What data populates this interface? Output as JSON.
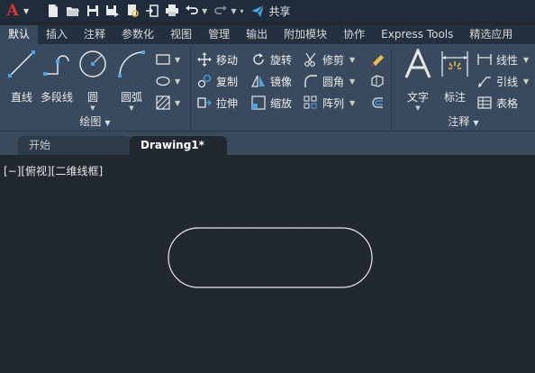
{
  "quick_access": {
    "app_menu_icon": "autocad-a-logo",
    "share_label": "共享",
    "icons": [
      "new-icon",
      "open-icon",
      "save-icon",
      "save-as-icon",
      "plot-preview-icon",
      "export-icon",
      "print-icon",
      "undo-icon",
      "redo-icon",
      "customize-icon"
    ]
  },
  "ribbon_tabs": [
    {
      "label": "默认",
      "active": true
    },
    {
      "label": "插入",
      "active": false
    },
    {
      "label": "注释",
      "active": false
    },
    {
      "label": "参数化",
      "active": false
    },
    {
      "label": "视图",
      "active": false
    },
    {
      "label": "管理",
      "active": false
    },
    {
      "label": "输出",
      "active": false
    },
    {
      "label": "附加模块",
      "active": false
    },
    {
      "label": "协作",
      "active": false
    },
    {
      "label": "Express Tools",
      "active": false
    },
    {
      "label": "精选应用",
      "active": false
    }
  ],
  "draw_panel": {
    "title": "绘图",
    "line_label": "直线",
    "polyline_label": "多段线",
    "circle_label": "圆",
    "arc_label": "圆弧"
  },
  "modify_panel": {
    "move": "移动",
    "rotate": "旋转",
    "trim": "修剪",
    "copy": "复制",
    "mirror": "镜像",
    "fillet": "圆角",
    "stretch": "拉伸",
    "scale": "缩放",
    "array": "阵列"
  },
  "annotation_panel": {
    "title": "注释",
    "text_label": "文字",
    "dimension_label": "标注",
    "linear_label": "线性",
    "leader_label": "引线",
    "table_label": "表格"
  },
  "doc_tabs": {
    "start": "开始",
    "drawing": "Drawing1*"
  },
  "viewport": {
    "label": "[−][俯视][二维线框]"
  },
  "colors": {
    "canvas": "#212830",
    "ribbon": "#3a4a5e",
    "logo_red": "#e0322f",
    "share_blue": "#4da3e0"
  }
}
